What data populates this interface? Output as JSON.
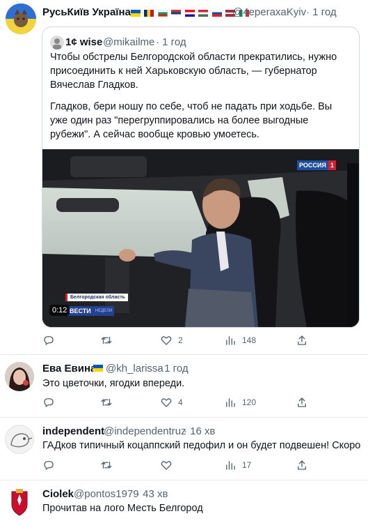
{
  "main_tweet": {
    "author": "РусьКиїв Україна",
    "handle": "@4eperaxaKyiv",
    "time": "· 1 год",
    "flags": [
      "ua",
      "ro",
      "bg",
      "rs",
      "hr",
      "hu",
      "sk",
      "lv",
      "it"
    ],
    "quote": {
      "author": "1¢ wise",
      "handle": "@mikailme",
      "time": "· 1 год",
      "text1": "Чтобы обстрелы Белгородской области прекратились, нужно присоединить к ней Харьковскую область, — губернатор Вячеслав Гладков.",
      "text2": "Гладков, бери ношу по себе, чтоб не падать при ходьбе. Вы уже один раз \"перегруппировались на более выгодные рубежи\". А сейчас вообще кровью умоетесь.",
      "video": {
        "channel_logo": "РОССИЯ",
        "channel_number": "1",
        "caption": "Белгородская область",
        "timestamp": "0:12",
        "show_logo": "ВЕСТИ",
        "show_sub": "НЕДЕЛИ"
      }
    },
    "actions": {
      "likes": "2",
      "views": "148"
    }
  },
  "replies": [
    {
      "author": "Ева Евина",
      "handle": "@kh_larissa",
      "time": "· 1 год",
      "text": "Это цветочки, ягодки впереди.",
      "likes": "4",
      "views": "120"
    },
    {
      "author": "independent",
      "handle": "@independentruz",
      "time": "· 16 хв",
      "text": "ГАДков типичный коцаппский педофил и он будет подвешен! Скоро",
      "likes": "",
      "views": "17"
    },
    {
      "author": "Ciolek",
      "handle": "@pontos1979",
      "time": "· 43 хв",
      "text": "Прочитав на лого Месть Белгород"
    }
  ],
  "colors": {
    "accent": "#1d9bf0",
    "muted": "#536471",
    "border": "#cfd9de"
  }
}
